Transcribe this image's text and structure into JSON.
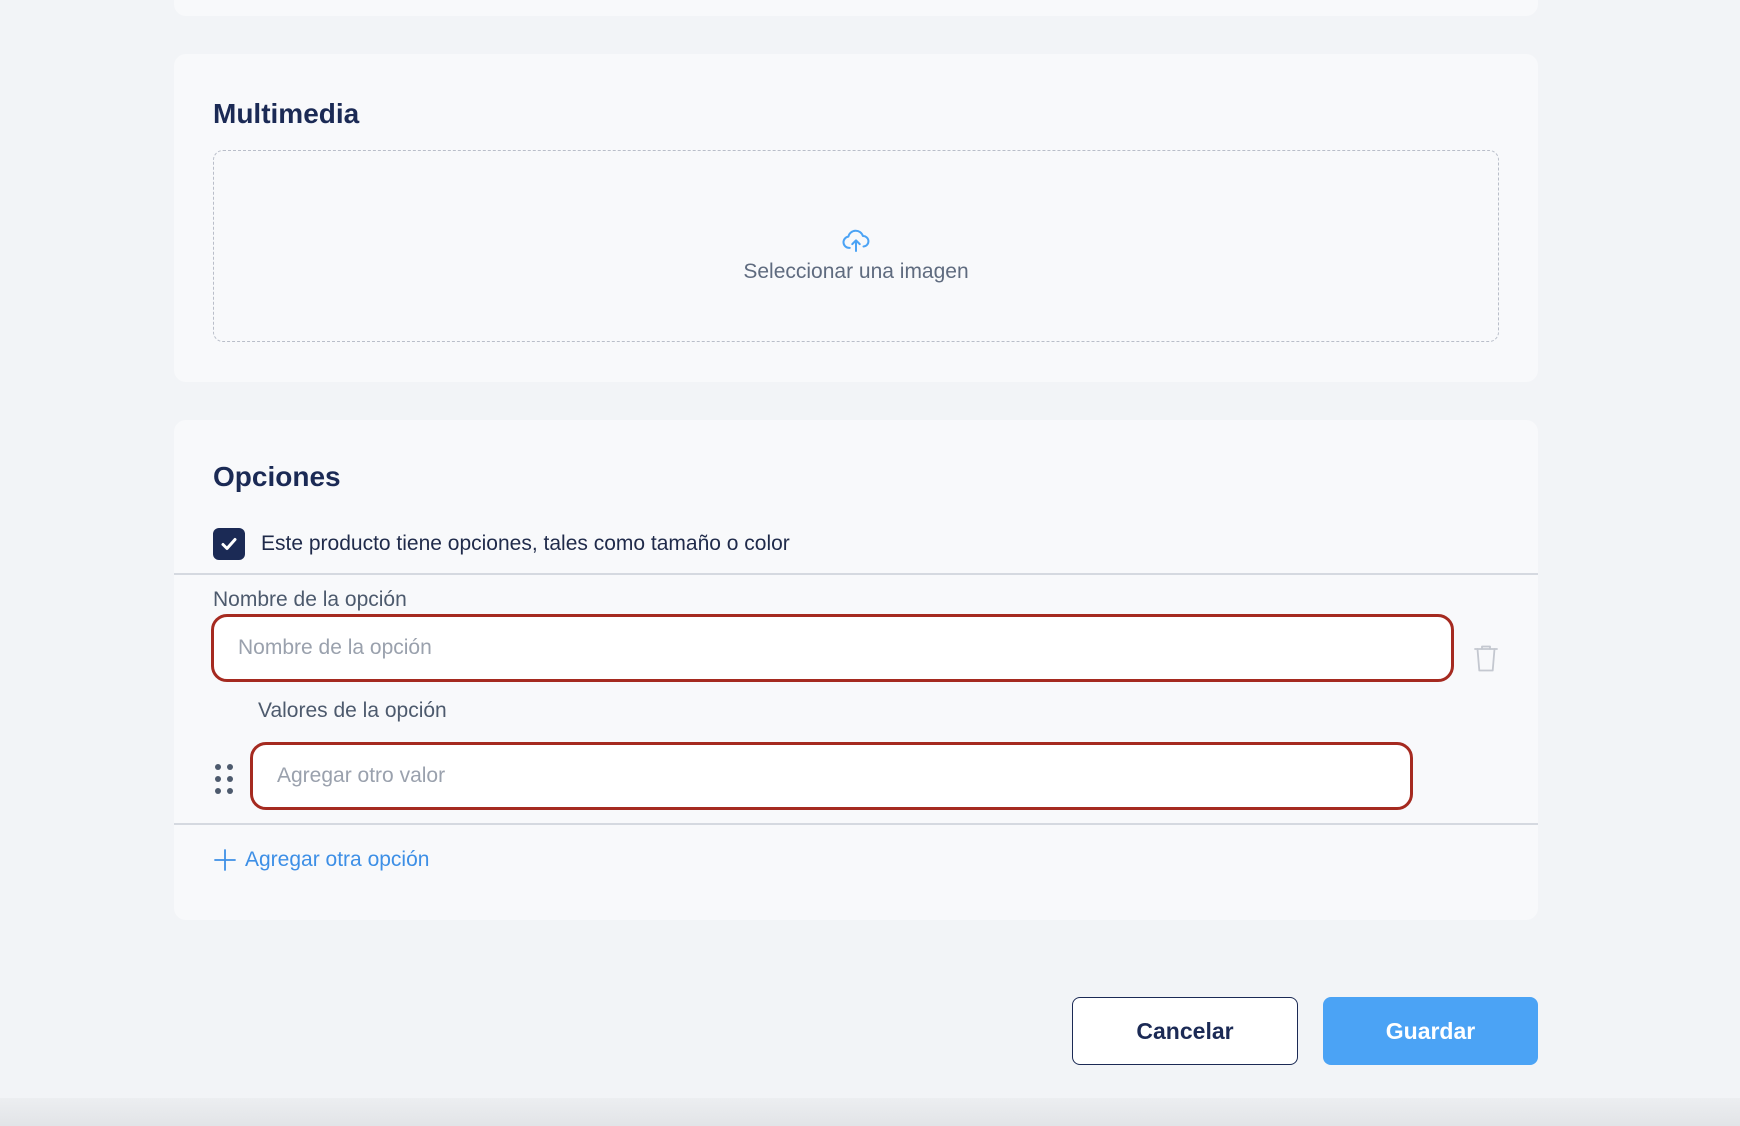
{
  "multimedia": {
    "title": "Multimedia",
    "upload_label": "Seleccionar una imagen",
    "upload_icon": "cloud-upload-icon"
  },
  "options": {
    "title": "Opciones",
    "has_options_checked": true,
    "has_options_label": "Este producto tiene opciones, tales como tamaño o color",
    "option_name_label": "Nombre de la opción",
    "option_name_placeholder": "Nombre de la opción",
    "option_name_value": "",
    "option_values_label": "Valores de la opción",
    "option_value_placeholder": "Agregar otro valor",
    "add_option_label": "Agregar otra opción"
  },
  "actions": {
    "cancel_label": "Cancelar",
    "save_label": "Guardar"
  },
  "colors": {
    "primary_navy": "#1b2a55",
    "accent_blue": "#4ba3f5",
    "link_blue": "#3d8fe6",
    "error_red": "#a52a20"
  }
}
